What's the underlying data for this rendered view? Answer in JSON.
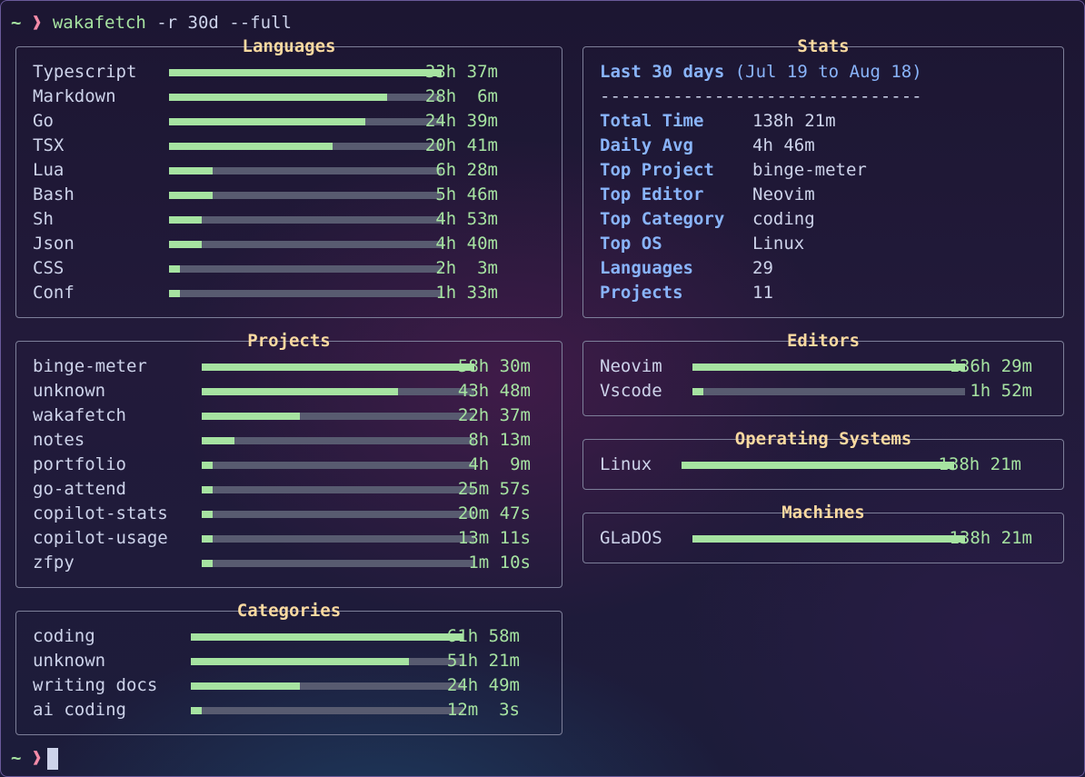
{
  "prompt": {
    "tilde": "~",
    "chevron": "❱",
    "command": "wakafetch",
    "args": "-r 30d --full"
  },
  "colors": {
    "bar_fill": "#a6e3a1",
    "bar_track": "#585b70",
    "box_title": "#f9d9a0",
    "stat_key": "#89b4fa"
  },
  "languages": {
    "title": "Languages",
    "items": [
      {
        "label": "Typescript",
        "value": "33h 37m",
        "fraction": 1.0
      },
      {
        "label": "Markdown",
        "value": "28h  6m",
        "fraction": 0.8
      },
      {
        "label": "Go",
        "value": "24h 39m",
        "fraction": 0.72
      },
      {
        "label": "TSX",
        "value": "20h 41m",
        "fraction": 0.6
      },
      {
        "label": "Lua",
        "value": "6h 28m",
        "fraction": 0.16
      },
      {
        "label": "Bash",
        "value": "5h 46m",
        "fraction": 0.16
      },
      {
        "label": "Sh",
        "value": "4h 53m",
        "fraction": 0.12
      },
      {
        "label": "Json",
        "value": "4h 40m",
        "fraction": 0.12
      },
      {
        "label": "CSS",
        "value": "2h  3m",
        "fraction": 0.04
      },
      {
        "label": "Conf",
        "value": "1h 33m",
        "fraction": 0.04
      }
    ]
  },
  "stats": {
    "title": "Stats",
    "period": "Last 30 days",
    "range": "(Jul 19 to Aug 18)",
    "separator": "-------------------------------",
    "rows": [
      {
        "key": "Total Time",
        "value": "138h 21m"
      },
      {
        "key": "Daily Avg",
        "value": "4h 46m"
      },
      {
        "key": "Top Project",
        "value": "binge-meter"
      },
      {
        "key": "Top Editor",
        "value": "Neovim"
      },
      {
        "key": "Top Category",
        "value": "coding"
      },
      {
        "key": "Top OS",
        "value": "Linux"
      },
      {
        "key": "Languages",
        "value": "29"
      },
      {
        "key": "Projects",
        "value": "11"
      }
    ]
  },
  "projects": {
    "title": "Projects",
    "items": [
      {
        "label": "binge-meter",
        "value": "58h 30m",
        "fraction": 1.0
      },
      {
        "label": "unknown",
        "value": "43h 48m",
        "fraction": 0.72
      },
      {
        "label": "wakafetch",
        "value": "22h 37m",
        "fraction": 0.36
      },
      {
        "label": "notes",
        "value": "8h 13m",
        "fraction": 0.12
      },
      {
        "label": "portfolio",
        "value": "4h  9m",
        "fraction": 0.04
      },
      {
        "label": "go-attend",
        "value": "25m 57s",
        "fraction": 0.04
      },
      {
        "label": "copilot-stats",
        "value": "20m 47s",
        "fraction": 0.04
      },
      {
        "label": "copilot-usage",
        "value": "13m 11s",
        "fraction": 0.04
      },
      {
        "label": "zfpy",
        "value": "1m 10s",
        "fraction": 0.04
      }
    ]
  },
  "editors": {
    "title": "Editors",
    "items": [
      {
        "label": "Neovim",
        "value": "136h 29m",
        "fraction": 1.0
      },
      {
        "label": "Vscode",
        "value": "1h 52m",
        "fraction": 0.04
      }
    ]
  },
  "operating_systems": {
    "title": "Operating Systems",
    "items": [
      {
        "label": "Linux",
        "value": "138h 21m",
        "fraction": 1.0
      }
    ]
  },
  "machines": {
    "title": "Machines",
    "items": [
      {
        "label": "GLaDOS",
        "value": "138h 21m",
        "fraction": 1.0
      }
    ]
  },
  "categories": {
    "title": "Categories",
    "items": [
      {
        "label": "coding",
        "value": "61h 58m",
        "fraction": 1.0
      },
      {
        "label": "unknown",
        "value": "51h 21m",
        "fraction": 0.8
      },
      {
        "label": "writing docs",
        "value": "24h 49m",
        "fraction": 0.4
      },
      {
        "label": "ai coding",
        "value": "12m  3s",
        "fraction": 0.04
      }
    ]
  },
  "prompt_end": {
    "tilde": "~",
    "chevron": "❱"
  }
}
